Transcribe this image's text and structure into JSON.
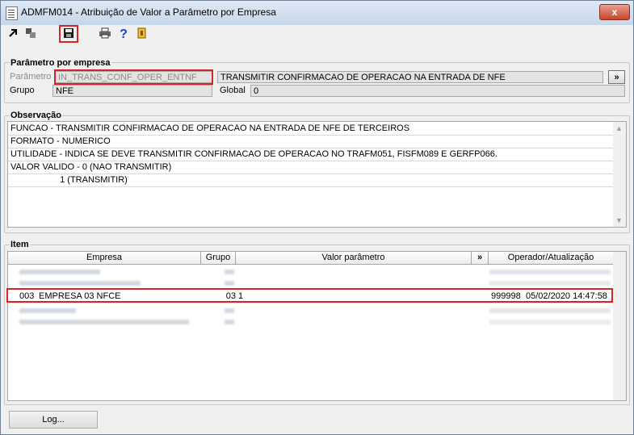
{
  "window": {
    "title": "ADMFM014 - Atribuição de Valor a Parâmetro por Empresa",
    "close_label": "x"
  },
  "toolbar": {
    "icons": [
      "expand-icon",
      "restore-icon",
      "save-icon",
      "print-icon",
      "help-icon",
      "exit-icon"
    ]
  },
  "parametro_section": {
    "title": "Parâmetro por empresa",
    "parametro_label": "Parâmetro",
    "parametro_value": "IN_TRANS_CONF_OPER_ENTNF",
    "descricao_value": "TRANSMITIR CONFIRMACAO DE OPERACAO NA ENTRADA DE NFE",
    "more_button": "»",
    "grupo_label": "Grupo",
    "grupo_value": "NFE",
    "global_label": "Global",
    "global_value": "0"
  },
  "observacao_section": {
    "title": "Observação",
    "lines": [
      "FUNCAO - TRANSMITIR CONFIRMACAO DE OPERACAO NA ENTRADA DE NFE DE TERCEIROS",
      "FORMATO - NUMERICO",
      "UTILIDADE - INDICA SE DEVE TRANSMITIR CONFIRMACAO DE OPERACAO NO TRAFM051, FISFM089 E GERFP066.",
      "VALOR VALIDO - 0 (NAO TRANSMITIR)",
      "                    1 (TRANSMITIR)"
    ]
  },
  "item_section": {
    "title": "Item",
    "columns": {
      "empresa": "Empresa",
      "grupo": "Grupo",
      "valor": "Valor parâmetro",
      "more": "»",
      "operador": "Operador/Atualização"
    },
    "selected_row": {
      "codigo": "003",
      "empresa": "EMPRESA 03 NFCE",
      "grupo": "03",
      "valor": "1",
      "operador": "999998",
      "atualizacao": "05/02/2020 14:47:58"
    }
  },
  "footer": {
    "log_button": "Log..."
  },
  "colors": {
    "highlight": "#d9222a",
    "title_bg": "#c6d6ea",
    "window_bg": "#f0f0f0"
  }
}
